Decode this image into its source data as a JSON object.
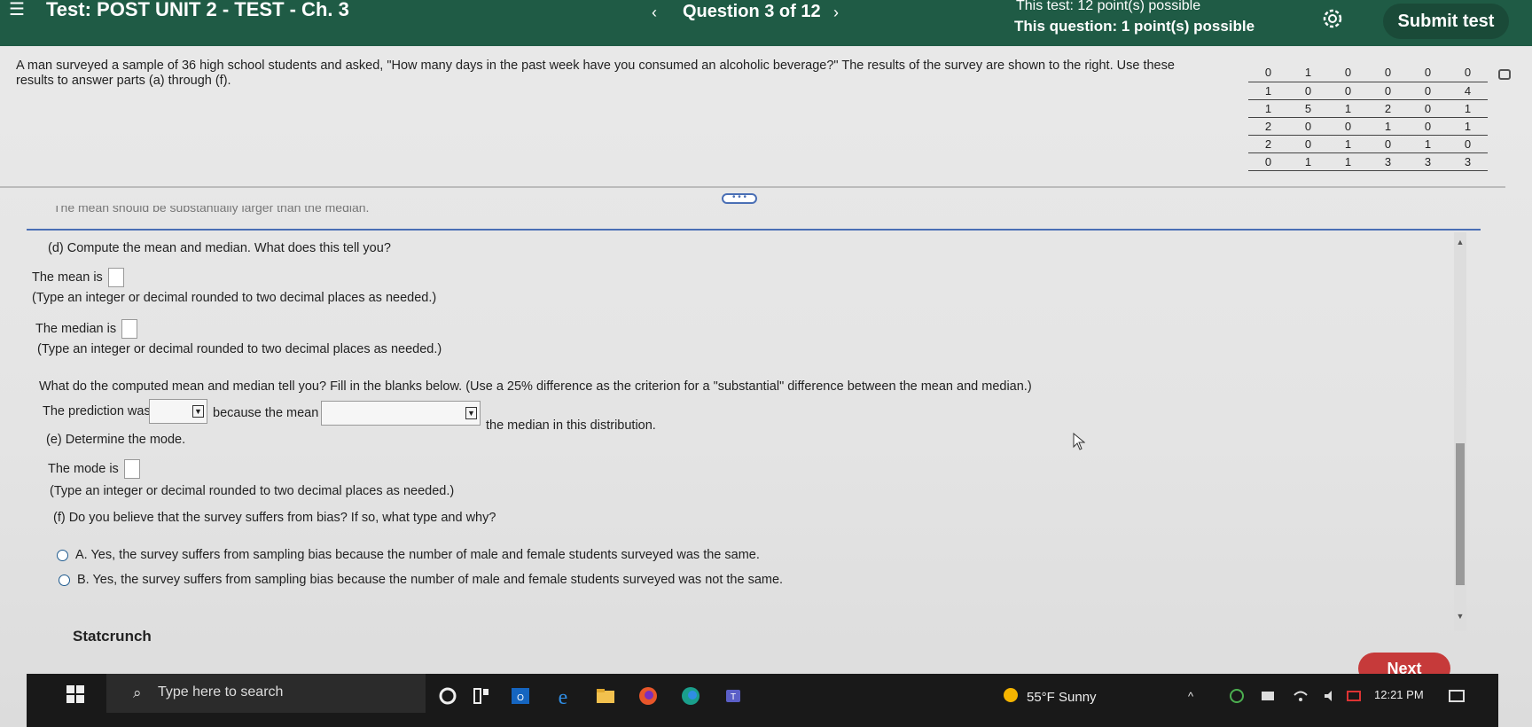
{
  "header": {
    "menu_icon": "menu-icon",
    "test_title": "Test: POST UNIT 2 - TEST - Ch. 3",
    "prev_arrow": "‹",
    "question_label": "Question 3 of 12",
    "next_arrow": "›",
    "test_points": "This test: 12 point(s) possible",
    "question_points": "This question: 1 point(s) possible",
    "settings_icon": "gear-icon",
    "submit_label": "Submit test",
    "bar_color": "#1f5b45"
  },
  "problem": {
    "text": "A man surveyed a sample of 36 high school students and asked, \"How many days in the past week have you consumed an alcoholic beverage?\" The results of the survey are shown to the right. Use these results to answer parts (a) through (f).",
    "table": [
      [
        "0",
        "1",
        "0",
        "0",
        "0",
        "0"
      ],
      [
        "1",
        "0",
        "0",
        "0",
        "0",
        "4"
      ],
      [
        "1",
        "5",
        "1",
        "2",
        "0",
        "1"
      ],
      [
        "2",
        "0",
        "0",
        "1",
        "0",
        "1"
      ],
      [
        "2",
        "0",
        "1",
        "0",
        "1",
        "0"
      ],
      [
        "0",
        "1",
        "1",
        "3",
        "3",
        "3"
      ]
    ]
  },
  "prev_answer_fragment": "The mean should be substantially larger than the median.",
  "part_d": {
    "prompt": "(d) Compute the mean and median. What does this tell you?",
    "mean_label": "The mean is",
    "mean_hint": "(Type an integer or decimal rounded to two decimal places as needed.)",
    "median_label": "The median is",
    "median_hint": "(Type an integer or decimal rounded to two decimal places as needed.)",
    "interpret_prompt": "What do the computed mean and median tell you? Fill in the blanks below. (Use a 25% difference as the criterion for a \"substantial\" difference between the mean and median.)",
    "prediction_label": "The prediction was",
    "because_label": "because the mean",
    "median_suffix": "the median in this distribution."
  },
  "part_e": {
    "prompt": "(e) Determine the mode.",
    "mode_label": "The mode is",
    "mode_hint": "(Type an integer or decimal rounded to two decimal places as needed.)"
  },
  "part_f": {
    "prompt": "(f) Do you believe that the survey suffers from bias? If so, what type and why?",
    "options": [
      "A.  Yes, the survey suffers from sampling bias because the number of male and female students surveyed was the same.",
      "B.  Yes, the survey suffers from sampling bias because the number of male and female students surveyed was not the same."
    ]
  },
  "footer": {
    "statcrunch": "Statcrunch",
    "next_label": "Next",
    "next_color": "#c63a3a"
  },
  "taskbar": {
    "search_placeholder": "Type here to search",
    "weather": "55°F  Sunny",
    "time": "12:21 PM",
    "icons": [
      "start-icon",
      "task-view-icon",
      "outlook-icon",
      "edge-legacy-icon",
      "file-explorer-icon",
      "firefox-icon",
      "edge-icon",
      "teams-icon"
    ]
  }
}
